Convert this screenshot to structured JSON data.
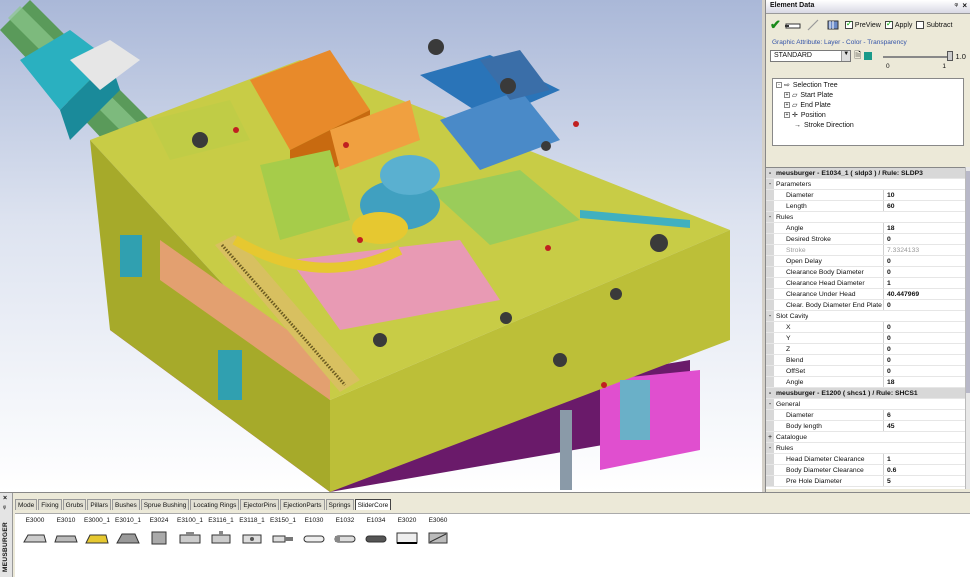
{
  "panel": {
    "title": "Element Data",
    "pin_glyph": "ᵠ",
    "close_glyph": "×",
    "preview_label": "PreView",
    "apply_label": "Apply",
    "subtract_label": "Subtract",
    "attr_label": "Graphic Attribute: Layer - Color - Transparency",
    "layer_value": "STANDARD",
    "transparency_value": "1.0",
    "transparency_fraction": 1.0,
    "scale_min": "0",
    "scale_max": "1",
    "accent_color": "#1a9a8a"
  },
  "tree": [
    {
      "label": "Selection Tree",
      "expander": "-",
      "icon": "arrow-icon"
    },
    {
      "label": "Start Plate",
      "expander": "+",
      "icon": "plate-icon"
    },
    {
      "label": "End Plate",
      "expander": "+",
      "icon": "plate-icon"
    },
    {
      "label": "Position",
      "expander": "+",
      "icon": "move-icon"
    },
    {
      "label": "Stroke Direction",
      "expander": "",
      "icon": "direction-icon"
    }
  ],
  "grid": [
    {
      "type": "hdr",
      "k": "meusburger - E1034_1 ( sldp3 )  / Rule: SLDP3",
      "ex": "-"
    },
    {
      "type": "cat",
      "k": "Parameters",
      "ex": "-"
    },
    {
      "k": "Diameter",
      "v": "10"
    },
    {
      "k": "Length",
      "v": "60"
    },
    {
      "type": "cat",
      "k": "Rules",
      "ex": "-"
    },
    {
      "k": "Angle",
      "v": "18"
    },
    {
      "k": "Desired Stroke",
      "v": "0"
    },
    {
      "type": "dim",
      "k": "Stroke",
      "v": "7.3324133"
    },
    {
      "k": "Open Delay",
      "v": "0"
    },
    {
      "k": "Clearance Body Diameter",
      "v": "0"
    },
    {
      "k": "Clearance Head Diameter",
      "v": "1"
    },
    {
      "k": "Clearance Under Head",
      "v": "40.447969"
    },
    {
      "k": "Clear. Body Diameter End Plate",
      "v": "0"
    },
    {
      "type": "cat",
      "k": "Slot Cavity",
      "ex": "-"
    },
    {
      "k": "X",
      "v": "0"
    },
    {
      "k": "Y",
      "v": "0"
    },
    {
      "k": "Z",
      "v": "0"
    },
    {
      "k": "Blend",
      "v": "0"
    },
    {
      "k": "OffSet",
      "v": "0"
    },
    {
      "k": "Angle",
      "v": "18"
    },
    {
      "type": "hdr",
      "k": "meusburger - E1200 ( shcs1 )  / Rule: SHCS1",
      "ex": "-"
    },
    {
      "type": "cat",
      "k": "General",
      "ex": "-"
    },
    {
      "k": "Diameter",
      "v": "6"
    },
    {
      "k": "Body length",
      "v": "45"
    },
    {
      "type": "cat",
      "k": "Catalogue",
      "ex": "+"
    },
    {
      "type": "cat",
      "k": "Rules",
      "ex": "-"
    },
    {
      "k": "Head Diameter Clearance",
      "v": "1"
    },
    {
      "k": "Body Diameter Clearance",
      "v": "0.6"
    },
    {
      "k": "Pre Hole Diameter",
      "v": "5"
    }
  ],
  "bottom": {
    "sidebar_label": "MEUSBURGER",
    "close_glyph": "×",
    "pin_glyph": "ᵠ",
    "tabs": [
      "Mode",
      "Fixing",
      "Grubs",
      "Pillars",
      "Bushes",
      "Sprue Bushing",
      "Locating Rings",
      "EjectorPins",
      "EjectionParts",
      "Springs",
      "SliderCore"
    ],
    "active_tab": "SliderCore",
    "tools": [
      "E3000",
      "E3010",
      "E3000_1",
      "E3010_1",
      "E3024",
      "E3100_1",
      "E3116_1",
      "E3118_1",
      "E3150_1",
      "E1030",
      "E1032",
      "E1034",
      "E3020",
      "E3060"
    ]
  }
}
